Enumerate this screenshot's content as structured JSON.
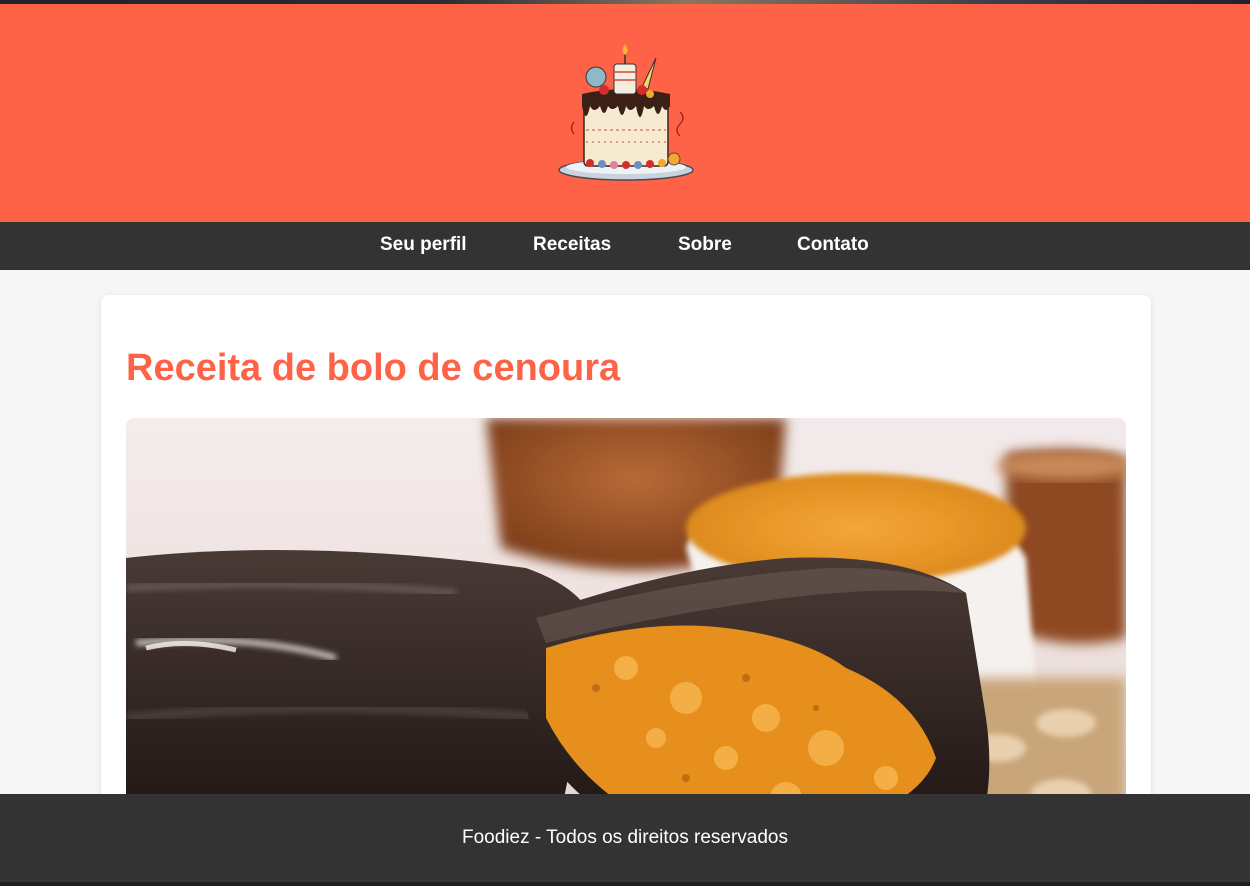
{
  "nav": {
    "items": [
      {
        "label": "Seu perfil"
      },
      {
        "label": "Receitas"
      },
      {
        "label": "Sobre"
      },
      {
        "label": "Contato"
      }
    ]
  },
  "header": {
    "logo_icon": "birthday-cake-icon",
    "background_color": "#ff6347"
  },
  "main": {
    "title": "Receita de bolo de cenoura",
    "image": "carrot-cake-with-chocolate-icing-photo"
  },
  "footer": {
    "text": "Foodiez - Todos os direitos reservados"
  },
  "colors": {
    "accent": "#ff6347",
    "nav_bg": "#333333",
    "page_bg": "#f6f6f6"
  }
}
